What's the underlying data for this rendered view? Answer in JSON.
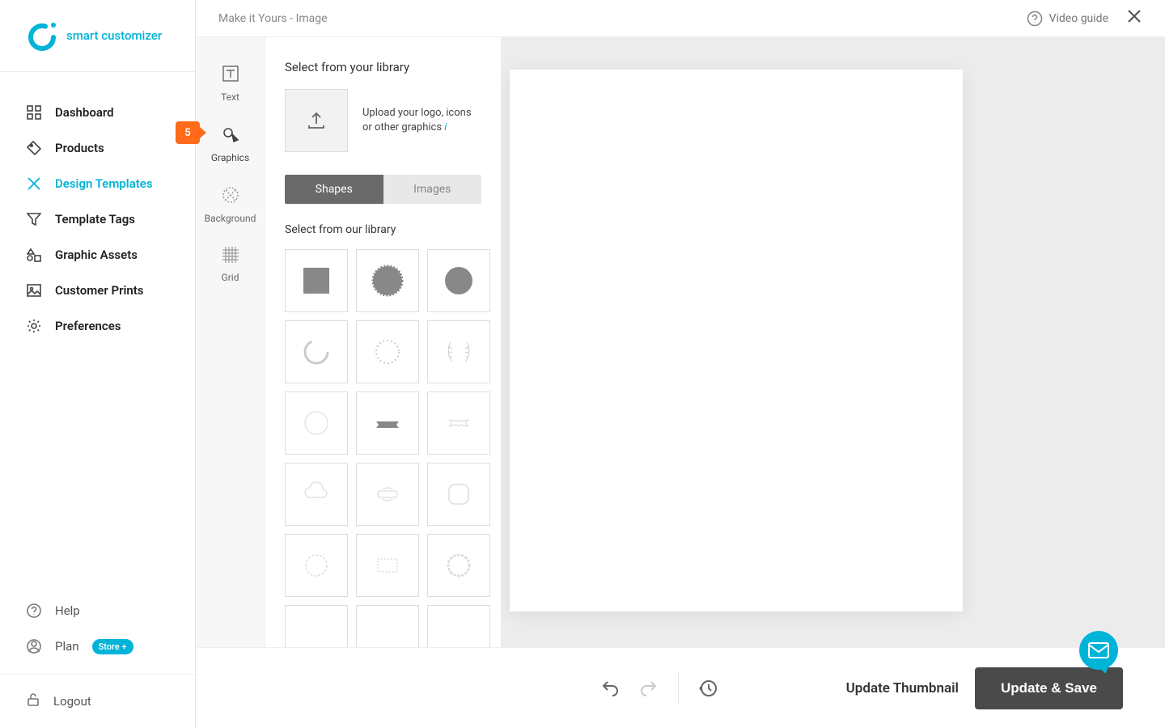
{
  "brand": {
    "name": "smart customizer"
  },
  "nav": {
    "items": [
      {
        "label": "Dashboard",
        "icon": "grid"
      },
      {
        "label": "Products",
        "icon": "tag"
      },
      {
        "label": "Design Templates",
        "icon": "palette"
      },
      {
        "label": "Template Tags",
        "icon": "funnel"
      },
      {
        "label": "Graphic Assets",
        "icon": "shapes"
      },
      {
        "label": "Customer Prints",
        "icon": "image"
      },
      {
        "label": "Preferences",
        "icon": "gear"
      }
    ],
    "active_index": 2
  },
  "nav_footer": {
    "help": "Help",
    "plan": "Plan",
    "plan_badge": "Store +",
    "logout": "Logout"
  },
  "breadcrumb": "Make it Yours - Image",
  "video_guide": "Video guide",
  "tool_col": {
    "items": [
      {
        "label": "Text"
      },
      {
        "label": "Graphics"
      },
      {
        "label": "Background"
      },
      {
        "label": "Grid"
      }
    ],
    "active_index": 1,
    "badge": "5"
  },
  "library": {
    "your_library": "Select from your library",
    "upload_text": "Upload your logo, icons or other graphics",
    "info_glyph": "i",
    "seg_shapes": "Shapes",
    "seg_images": "Images",
    "our_library": "Select from our library"
  },
  "footer": {
    "update_thumbnail": "Update Thumbnail",
    "update_save": "Update & Save"
  }
}
